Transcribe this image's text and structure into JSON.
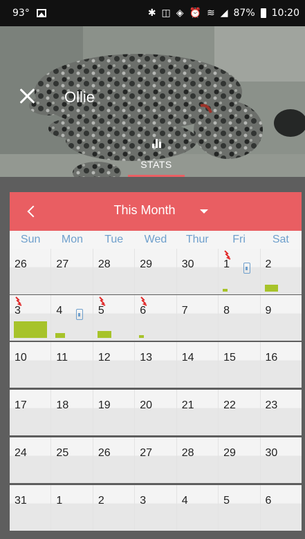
{
  "status_bar": {
    "temperature": "93°",
    "battery": "87%",
    "time": "10:20"
  },
  "header": {
    "dog_name": "Ollie",
    "tab_label": "STATS"
  },
  "calendar": {
    "month_title": "This Month",
    "weekdays": [
      "Sun",
      "Mon",
      "Tue",
      "Wed",
      "Thur",
      "Fri",
      "Sat"
    ],
    "weeks": [
      [
        {
          "day": "26",
          "activity": 0,
          "treat": false,
          "device": false
        },
        {
          "day": "27",
          "activity": 0,
          "treat": false,
          "device": false
        },
        {
          "day": "28",
          "activity": 0,
          "treat": false,
          "device": false
        },
        {
          "day": "29",
          "activity": 0,
          "treat": false,
          "device": false
        },
        {
          "day": "30",
          "activity": 0,
          "treat": false,
          "device": false
        },
        {
          "day": "1",
          "activity": 0.15,
          "treat": true,
          "device": true
        },
        {
          "day": "2",
          "activity": 0.4,
          "treat": false,
          "device": false
        }
      ],
      [
        {
          "day": "3",
          "activity": 1.0,
          "treat": true,
          "device": false
        },
        {
          "day": "4",
          "activity": 0.3,
          "treat": false,
          "device": true
        },
        {
          "day": "5",
          "activity": 0.42,
          "treat": true,
          "device": false
        },
        {
          "day": "6",
          "activity": 0.15,
          "treat": true,
          "device": false
        },
        {
          "day": "7",
          "activity": 0,
          "treat": false,
          "device": false
        },
        {
          "day": "8",
          "activity": 0,
          "treat": false,
          "device": false
        },
        {
          "day": "9",
          "activity": 0,
          "treat": false,
          "device": false
        }
      ],
      [
        {
          "day": "10"
        },
        {
          "day": "11"
        },
        {
          "day": "12"
        },
        {
          "day": "13"
        },
        {
          "day": "14"
        },
        {
          "day": "15"
        },
        {
          "day": "16"
        }
      ],
      [
        {
          "day": "17"
        },
        {
          "day": "18"
        },
        {
          "day": "19"
        },
        {
          "day": "20"
        },
        {
          "day": "21"
        },
        {
          "day": "22"
        },
        {
          "day": "23"
        }
      ],
      [
        {
          "day": "24"
        },
        {
          "day": "25"
        },
        {
          "day": "26"
        },
        {
          "day": "27"
        },
        {
          "day": "28"
        },
        {
          "day": "29"
        },
        {
          "day": "30"
        }
      ],
      [
        {
          "day": "31"
        },
        {
          "day": "1"
        },
        {
          "day": "2"
        },
        {
          "day": "3"
        },
        {
          "day": "4"
        },
        {
          "day": "5"
        },
        {
          "day": "6"
        }
      ]
    ]
  },
  "colors": {
    "accent": "#e95e62",
    "weekday_text": "#6e9fcc",
    "activity": "#a7c32a",
    "treat": "#e02a2a"
  }
}
